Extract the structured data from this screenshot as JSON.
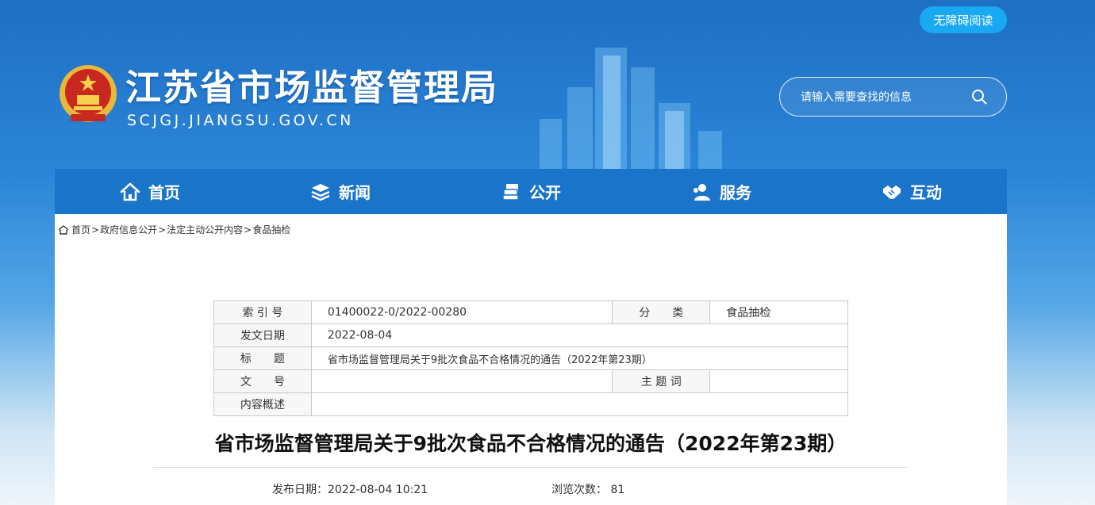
{
  "header": {
    "site_title": "江苏省市场监督管理局",
    "site_domain": "SCJGJ.JIANGSU.GOV.CN",
    "a11y_label": "无障碍阅读",
    "search_placeholder": "请输入需要查找的信息"
  },
  "nav": {
    "items": [
      {
        "label": "首页",
        "icon": "home-icon"
      },
      {
        "label": "新闻",
        "icon": "layers-icon"
      },
      {
        "label": "公开",
        "icon": "document-stack-icon"
      },
      {
        "label": "服务",
        "icon": "person-icon"
      },
      {
        "label": "互动",
        "icon": "handshake-icon"
      }
    ]
  },
  "breadcrumb": {
    "icon": "home-icon",
    "items": [
      "首页",
      "政府信息公开",
      "法定主动公开内容",
      "食品抽检"
    ],
    "separator": ">"
  },
  "meta_table": {
    "index_label": "索 引 号",
    "index_value": "01400022-0/2022-00280",
    "category_label": "分　　类",
    "category_value": "食品抽检",
    "date_label": "发文日期",
    "date_value": "2022-08-04",
    "title_label": "标　　题",
    "title_value": "省市场监督管理局关于9批次食品不合格情况的通告（2022年第23期）",
    "docno_label": "文　　号",
    "docno_value": "",
    "keywords_label": "主 题 词",
    "keywords_value": "",
    "summary_label": "内容概述",
    "summary_value": ""
  },
  "article": {
    "title": "省市场监督管理局关于9批次食品不合格情况的通告（2022年第23期）",
    "publish_label": "发布日期：",
    "publish_value": "2022-08-04 10:21",
    "views_label": "浏览次数：",
    "views_value": "81"
  },
  "colors": {
    "nav_bg": "#1a74c9",
    "a11y_bg": "#18a9f2",
    "header_top": "#1f6fc4"
  }
}
